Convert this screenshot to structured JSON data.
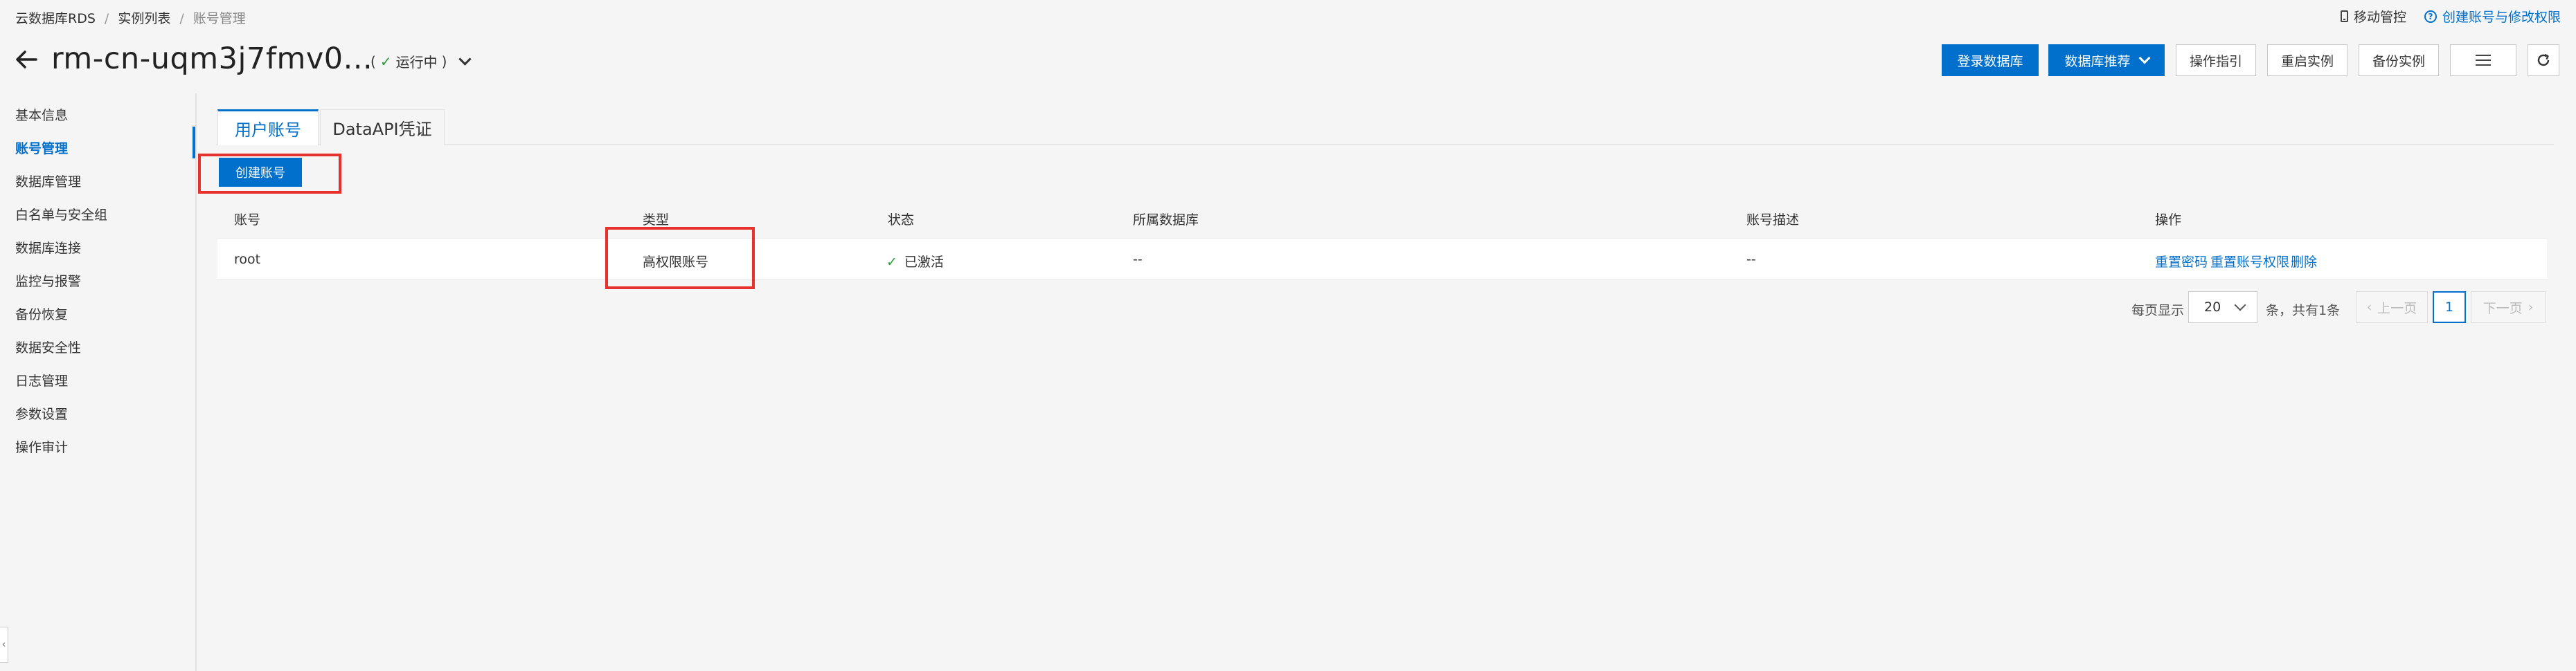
{
  "breadcrumb": {
    "items": [
      "云数据库RDS",
      "实例列表",
      "账号管理"
    ]
  },
  "top_right": {
    "mobile_label": "移动管控",
    "help_link": "创建账号与修改权限"
  },
  "header": {
    "title": "rm-cn-uqm3j7fmv0...",
    "status_prefix": "(",
    "status_check": "✓",
    "status_text": "运行中",
    "status_suffix": ")",
    "buttons": {
      "login": "登录数据库",
      "recommend": "数据库推荐",
      "guide": "操作指引",
      "restart": "重启实例",
      "backup": "备份实例"
    }
  },
  "sidebar": {
    "items": [
      {
        "label": "基本信息",
        "active": false
      },
      {
        "label": "账号管理",
        "active": true
      },
      {
        "label": "数据库管理",
        "active": false
      },
      {
        "label": "白名单与安全组",
        "active": false
      },
      {
        "label": "数据库连接",
        "active": false
      },
      {
        "label": "监控与报警",
        "active": false
      },
      {
        "label": "备份恢复",
        "active": false
      },
      {
        "label": "数据安全性",
        "active": false
      },
      {
        "label": "日志管理",
        "active": false
      },
      {
        "label": "参数设置",
        "active": false
      },
      {
        "label": "操作审计",
        "active": false
      }
    ],
    "collapse_glyph": "‹"
  },
  "tabs": [
    {
      "label": "用户账号",
      "active": true
    },
    {
      "label": "DataAPI凭证",
      "active": false
    }
  ],
  "create_button": "创建账号",
  "table": {
    "headers": [
      "账号",
      "类型",
      "状态",
      "所属数据库",
      "账号描述",
      "操作"
    ],
    "rows": [
      {
        "account": "root",
        "type": "高权限账号",
        "status_icon": "✓",
        "status": "已激活",
        "database": "--",
        "description": "--",
        "actions": [
          "重置密码",
          "重置账号权限",
          "删除"
        ]
      }
    ]
  },
  "pagination": {
    "per_page_label": "每页显示",
    "per_page": "20",
    "total_text": "条，共有1条",
    "prev": "上一页",
    "current": "1",
    "next": "下一页"
  },
  "colors": {
    "accent": "#0070cc",
    "highlight_box": "#e8302c",
    "success": "#2a9d3c"
  }
}
